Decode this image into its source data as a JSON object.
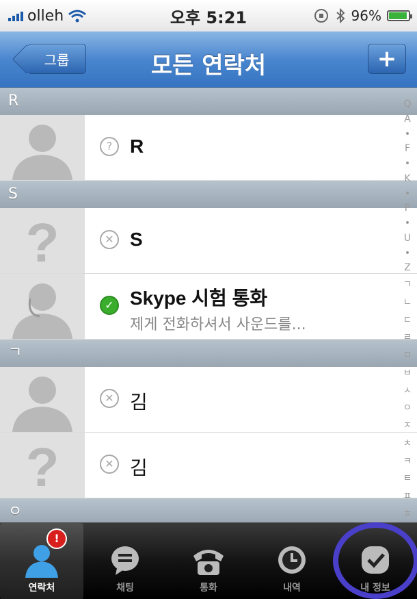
{
  "status_bar": {
    "carrier": "olleh",
    "time": "오후 5:21",
    "battery": "96%",
    "icon_names": [
      "signal-icon",
      "wifi-icon",
      "lock-rotation-icon",
      "bluetooth-icon",
      "battery-icon"
    ]
  },
  "nav": {
    "back_label": "그룹",
    "title": "모든 연락처",
    "add_label": "+"
  },
  "sections": [
    {
      "letter": "R"
    },
    {
      "letter": "S"
    },
    {
      "letter": "ㄱ"
    },
    {
      "letter": "ㅇ"
    }
  ],
  "contacts": [
    {
      "name": "R",
      "status": "unknown",
      "avatar": "person",
      "sub": ""
    },
    {
      "name": "S",
      "status": "offline",
      "avatar": "question",
      "sub": ""
    },
    {
      "name": "Skype 시험 통화",
      "status": "online",
      "avatar": "headset-person",
      "sub": "제게 전화하셔서 사운드를..."
    },
    {
      "name": "김",
      "status": "offline",
      "avatar": "person",
      "sub": ""
    },
    {
      "name": "김",
      "status": "offline",
      "avatar": "question",
      "sub": ""
    }
  ],
  "index": [
    "Q",
    "A",
    "•",
    "F",
    "•",
    "K",
    "•",
    "P",
    "•",
    "U",
    "•",
    "Z",
    "ㄱ",
    "ㄴ",
    "ㄷ",
    "ㄹ",
    "ㅁ",
    "ㅂ",
    "ㅅ",
    "ㅇ",
    "ㅈ",
    "ㅊ",
    "ㅋ",
    "ㅌ",
    "ㅍ",
    "ㅎ"
  ],
  "tabs": [
    {
      "label": "연락처",
      "icon": "contacts-icon",
      "active": true,
      "badge": "!"
    },
    {
      "label": "채팅",
      "icon": "chat-icon",
      "active": false
    },
    {
      "label": "통화",
      "icon": "phone-icon",
      "active": false
    },
    {
      "label": "내역",
      "icon": "history-clock-icon",
      "active": false
    },
    {
      "label": "내 정보",
      "icon": "my-info-check-icon",
      "active": false
    }
  ],
  "colors": {
    "nav_blue": "#3574c2",
    "online_green": "#3aae2c",
    "badge_red": "#d91e1e",
    "highlight_circle": "#4a3fc8"
  }
}
